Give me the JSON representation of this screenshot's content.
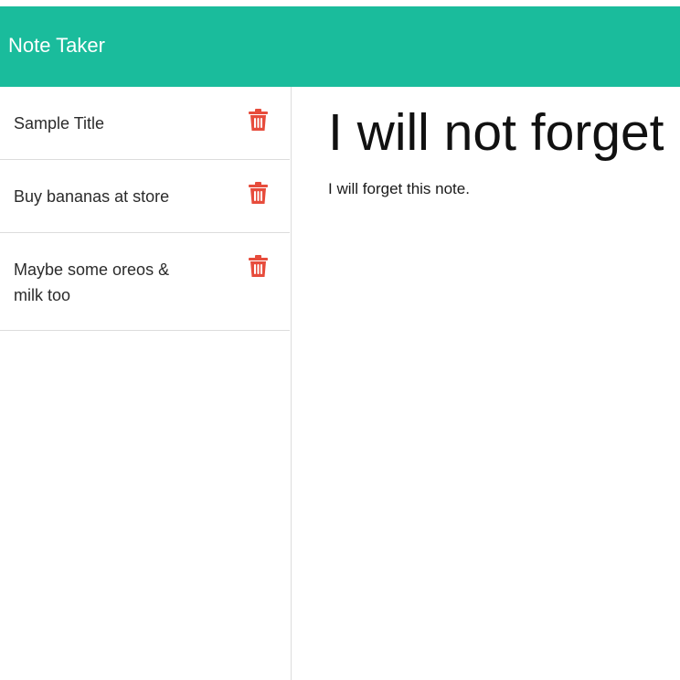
{
  "app": {
    "title": "Note Taker",
    "accent_color": "#1abc9c",
    "delete_color": "#e74c3c"
  },
  "sidebar": {
    "notes": [
      {
        "title": "Sample Title",
        "action_icon": "trash-icon"
      },
      {
        "title": "Buy bananas at store",
        "action_icon": "trash-icon"
      },
      {
        "title": "Maybe some oreos & milk too",
        "action_icon": "trash-icon"
      }
    ]
  },
  "main": {
    "note_title": "I will not forget",
    "note_text": "I will forget this note."
  }
}
